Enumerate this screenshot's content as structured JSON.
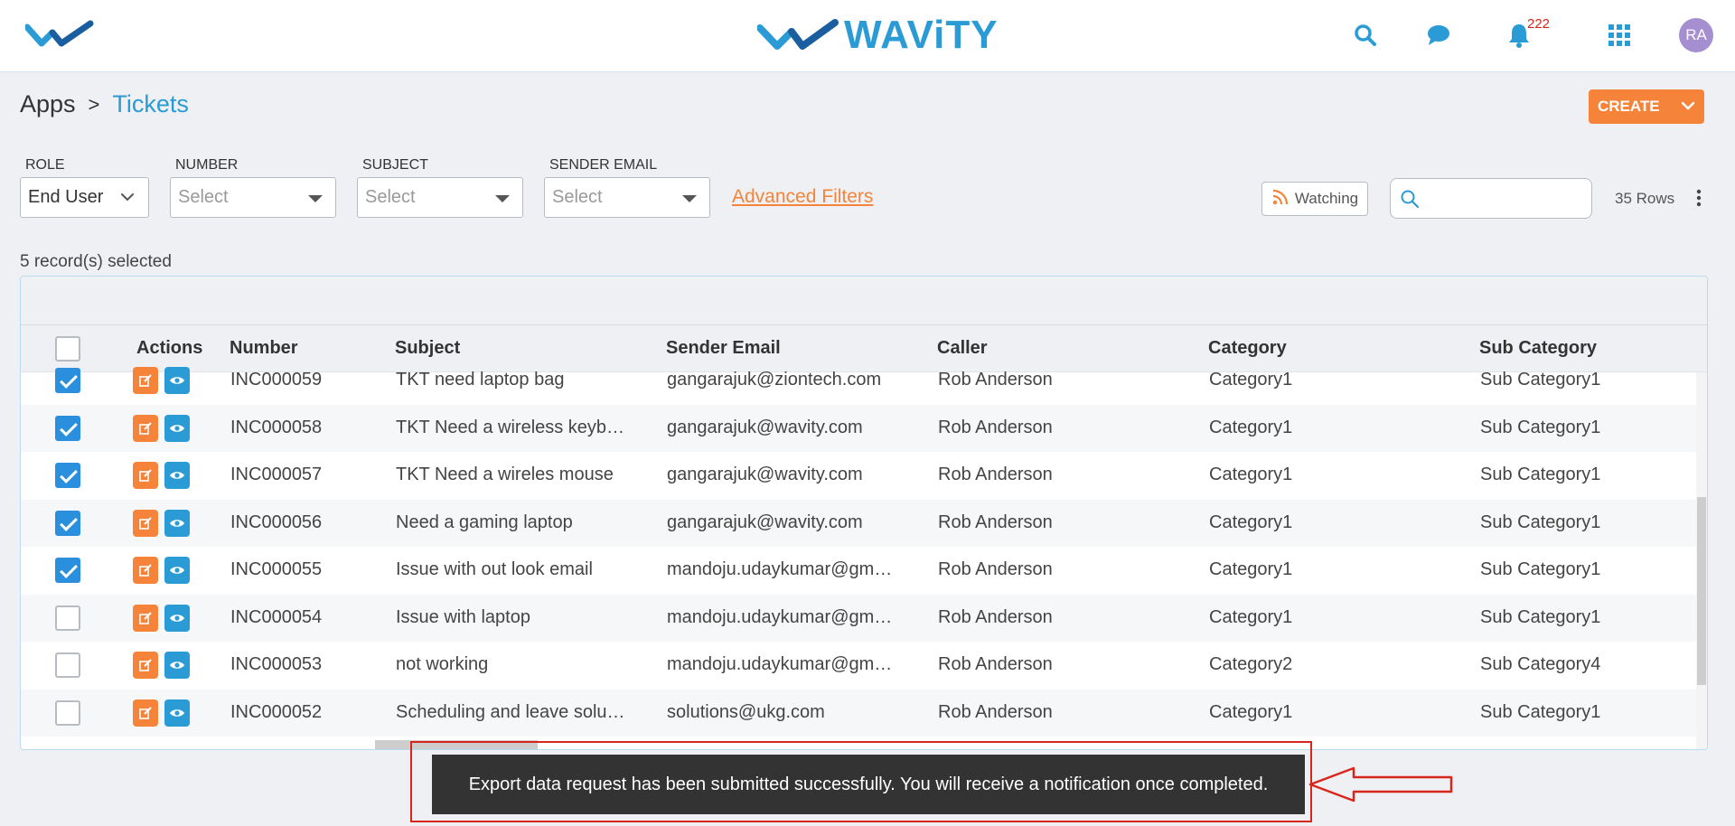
{
  "header": {
    "logo_text": "WAViTY",
    "notification_count": "222",
    "avatar_initials": "RA"
  },
  "breadcrumb": {
    "parent": "Apps",
    "separator": ">",
    "current": "Tickets"
  },
  "create_button": {
    "label": "CREATE"
  },
  "filters": {
    "role": {
      "label": "ROLE",
      "value": "End User"
    },
    "number": {
      "label": "NUMBER",
      "placeholder": "Select"
    },
    "subject": {
      "label": "SUBJECT",
      "placeholder": "Select"
    },
    "sender_email": {
      "label": "SENDER EMAIL",
      "placeholder": "Select"
    },
    "advanced_link": "Advanced Filters"
  },
  "toolbar": {
    "watching_label": "Watching",
    "search_value": "",
    "rows_count": "35 Rows"
  },
  "selection_info": "5 record(s) selected",
  "table": {
    "columns": [
      "Actions",
      "Number",
      "Subject",
      "Sender Email",
      "Caller",
      "Category",
      "Sub Category"
    ],
    "rows": [
      {
        "checked": true,
        "number": "INC000059",
        "subject": "TKT need laptop bag",
        "email": "gangarajuk@ziontech.com",
        "caller": "Rob Anderson",
        "category": "Category1",
        "subcategory": "Sub Category1"
      },
      {
        "checked": true,
        "number": "INC000058",
        "subject": "TKT Need a wireless keyb…",
        "email": "gangarajuk@wavity.com",
        "caller": "Rob Anderson",
        "category": "Category1",
        "subcategory": "Sub Category1"
      },
      {
        "checked": true,
        "number": "INC000057",
        "subject": "TKT Need a wireles mouse",
        "email": "gangarajuk@wavity.com",
        "caller": "Rob Anderson",
        "category": "Category1",
        "subcategory": "Sub Category1"
      },
      {
        "checked": true,
        "number": "INC000056",
        "subject": "Need a gaming laptop",
        "email": "gangarajuk@wavity.com",
        "caller": "Rob Anderson",
        "category": "Category1",
        "subcategory": "Sub Category1"
      },
      {
        "checked": true,
        "number": "INC000055",
        "subject": "Issue with out look email",
        "email": "mandoju.udaykumar@gm…",
        "caller": "Rob Anderson",
        "category": "Category1",
        "subcategory": "Sub Category1"
      },
      {
        "checked": false,
        "number": "INC000054",
        "subject": "Issue with laptop",
        "email": "mandoju.udaykumar@gm…",
        "caller": "Rob Anderson",
        "category": "Category1",
        "subcategory": "Sub Category1"
      },
      {
        "checked": false,
        "number": "INC000053",
        "subject": "not working",
        "email": "mandoju.udaykumar@gm…",
        "caller": "Rob Anderson",
        "category": "Category2",
        "subcategory": "Sub Category4"
      },
      {
        "checked": false,
        "number": "INC000052",
        "subject": "Scheduling and leave solu…",
        "email": "solutions@ukg.com",
        "caller": "Rob Anderson",
        "category": "Category1",
        "subcategory": "Sub Category1"
      }
    ]
  },
  "toast": {
    "message": "Export data request has been submitted successfully. You will receive a notification once completed."
  },
  "colors": {
    "brand_blue": "#2a9bd5",
    "accent_orange": "#f5843a",
    "annotation_red": "#d9261c"
  }
}
